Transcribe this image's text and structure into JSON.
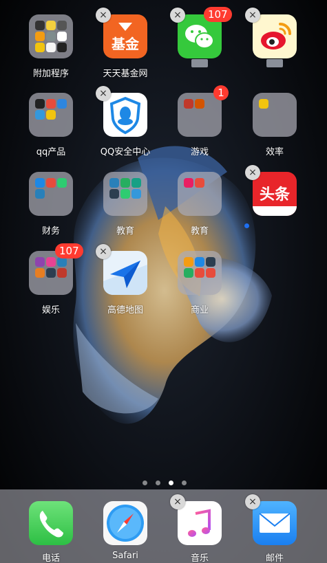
{
  "home": {
    "row1": [
      {
        "label": "附加程序",
        "type": "folder"
      },
      {
        "label": "天天基金网",
        "icon_text": "基金",
        "icon": "fund-icon",
        "deletable": true
      },
      {
        "label": "",
        "icon": "wechat-icon",
        "deletable": true,
        "badge": "107"
      },
      {
        "label": "",
        "icon": "weibo-icon",
        "deletable": true
      }
    ],
    "row2": [
      {
        "label": "qq产品",
        "type": "folder"
      },
      {
        "label": "QQ安全中心",
        "icon": "qq-security-icon",
        "deletable": true
      },
      {
        "label": "游戏",
        "type": "folder",
        "badge": "1"
      },
      {
        "label": "效率",
        "type": "folder"
      }
    ],
    "row3": [
      {
        "label": "财务",
        "type": "folder"
      },
      {
        "label": "教育",
        "type": "folder"
      },
      {
        "label": "教育",
        "type": "folder"
      },
      {
        "label": "",
        "icon": "toutiao-icon",
        "icon_text": "头条",
        "deletable": true
      }
    ],
    "row4": [
      {
        "label": "娱乐",
        "type": "folder",
        "badge": "107"
      },
      {
        "label": "高德地图",
        "icon": "amap-icon",
        "deletable": true
      },
      {
        "label": "商业",
        "type": "folder"
      }
    ]
  },
  "page_dots": {
    "count": 4,
    "active": 2
  },
  "dock": [
    {
      "label": "电话",
      "icon": "phone-icon"
    },
    {
      "label": "Safari",
      "icon": "safari-icon"
    },
    {
      "label": "音乐",
      "icon": "music-icon",
      "deletable": true
    },
    {
      "label": "邮件",
      "icon": "mail-icon",
      "deletable": true
    }
  ],
  "delete_glyph": "×",
  "colors": {
    "badge": "#ff3b30",
    "fund": "#f26522",
    "wechat": "#35c93c",
    "toutiao": "#e8252a",
    "phone": "#4cd964",
    "mail": "#1a8cf0"
  }
}
